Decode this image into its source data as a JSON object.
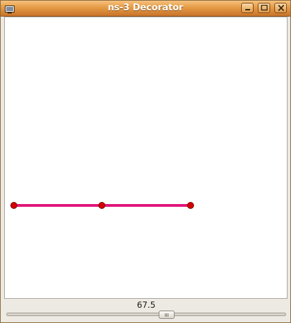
{
  "window": {
    "title": "ns-3 Decorator"
  },
  "titlebar_buttons": [
    "minimize-icon",
    "maximize-icon",
    "close-icon"
  ],
  "app_icon": "window-icon",
  "canvas": {
    "background": "#ffffff",
    "link_color": "#e0157a",
    "node_color": "#d40000"
  },
  "slider": {
    "value_label": "67.5"
  }
}
